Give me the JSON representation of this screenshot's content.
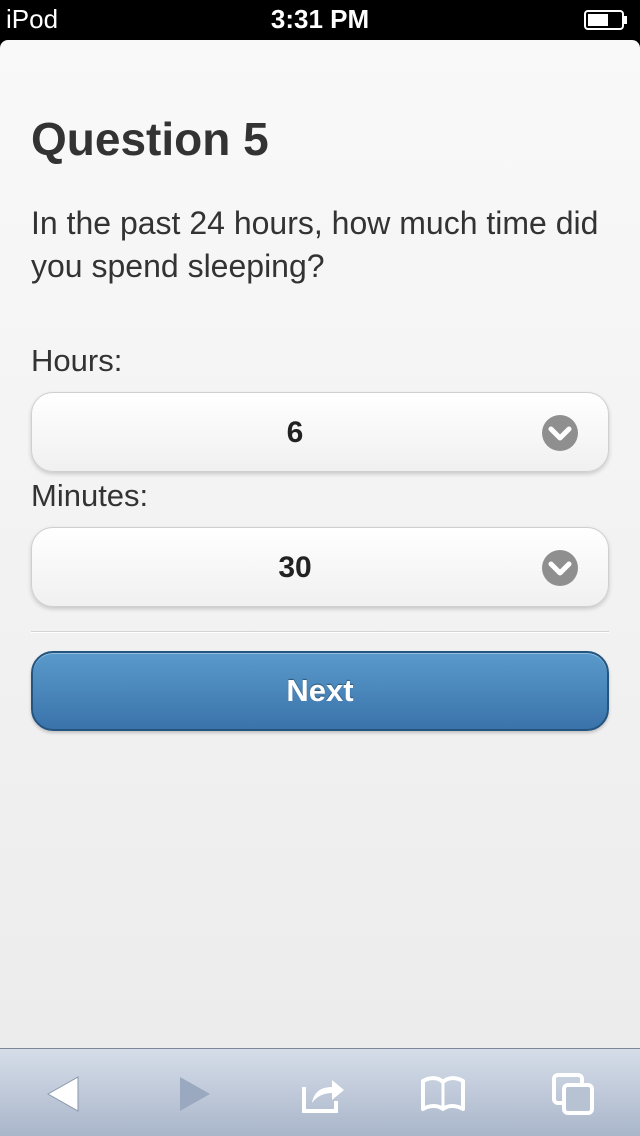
{
  "status_bar": {
    "carrier": "iPod",
    "time": "3:31 PM",
    "battery_icon": "battery-icon"
  },
  "question": {
    "title": "Question 5",
    "prompt": "In the past 24 hours, how much time did you spend sleeping?"
  },
  "fields": {
    "hours": {
      "label": "Hours:",
      "value": "6",
      "icon": "chevron-down-icon"
    },
    "minutes": {
      "label": "Minutes:",
      "value": "30",
      "icon": "chevron-down-icon"
    }
  },
  "actions": {
    "next_label": "Next"
  },
  "colors": {
    "accent": "#3a73aa",
    "accent_border": "#245480",
    "toolbar": "#b7c2d3"
  },
  "toolbar": {
    "items": [
      "back-icon",
      "forward-icon",
      "share-icon",
      "bookmarks-icon",
      "tabs-icon"
    ]
  }
}
